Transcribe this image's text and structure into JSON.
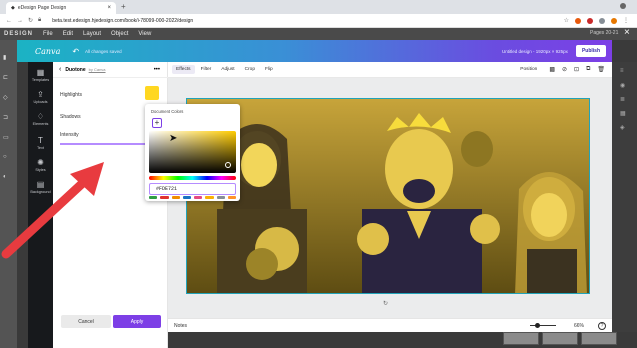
{
  "browser": {
    "tab_title": "eDesign Page Design",
    "url": "beta.test.edesign.hjedesign.com/book/i-78099-000-2022/design"
  },
  "host": {
    "brand": "DESIGN",
    "menu": [
      "File",
      "Edit",
      "Layout",
      "Object",
      "View"
    ],
    "pages_label": "Pages 20-21"
  },
  "canva": {
    "logo": "Canva",
    "saved_text": "All changes saved",
    "design_title": "Untitled design - 1920px × 925px",
    "publish": "Publish"
  },
  "sidebar": {
    "items": [
      {
        "label": "Templates",
        "icon": "templates-icon",
        "glyph": "▦"
      },
      {
        "label": "Uploads",
        "icon": "upload-icon",
        "glyph": "⇪"
      },
      {
        "label": "Elements",
        "icon": "elements-icon",
        "glyph": "♢"
      },
      {
        "label": "Text",
        "icon": "text-icon",
        "glyph": "T"
      },
      {
        "label": "Styles",
        "icon": "styles-icon",
        "glyph": "✺"
      },
      {
        "label": "Background",
        "icon": "background-icon",
        "glyph": "▤"
      }
    ]
  },
  "panel": {
    "back": "‹",
    "title": "Duotone",
    "by": "by Canva",
    "more": "•••",
    "highlights": "Highlights",
    "shadows": "Shadows",
    "intensity": "Intensity",
    "highlight_color": "#FFD721",
    "cancel": "Cancel",
    "apply": "Apply"
  },
  "toolbar": {
    "tabs": [
      "Effects",
      "Filter",
      "Adjust",
      "Crop",
      "Flip"
    ],
    "active_tab": "Effects",
    "position": "Position"
  },
  "picker": {
    "title": "Document Colors",
    "add": "+",
    "hex": "#FDE721",
    "swatch_colors": [
      "#2f9e44",
      "#e03131",
      "#f08c00",
      "#1971c2",
      "#e64980",
      "#fab005",
      "#868e96",
      "#ff922b"
    ]
  },
  "notes": {
    "label": "Notes",
    "zoom": "66%",
    "help": "?",
    "zoom_level": 0.25
  },
  "colors": {
    "accent": "#7d3fe6",
    "duotone_highlight": "#FFD721",
    "duotone_shadow": "#2a2440"
  }
}
